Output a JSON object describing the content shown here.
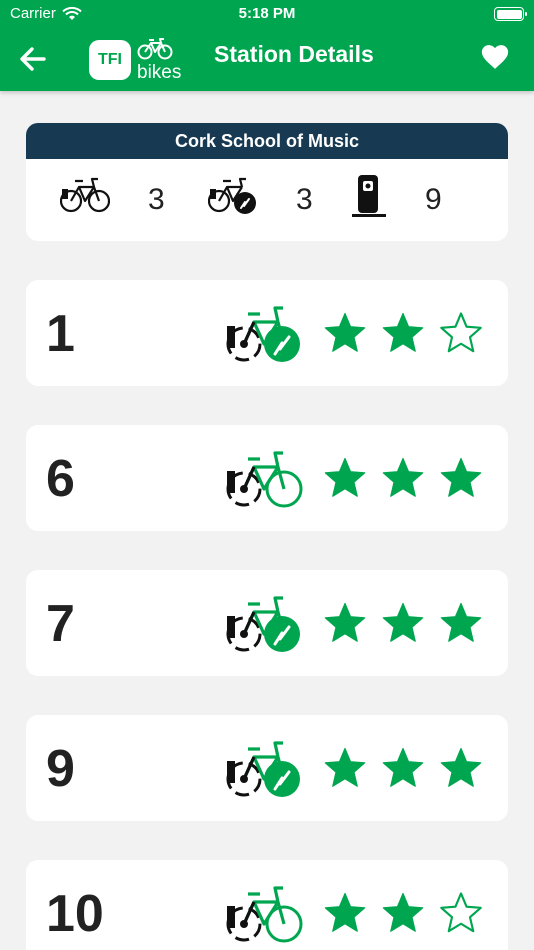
{
  "status_bar": {
    "carrier": "Carrier",
    "time": "5:18 PM"
  },
  "header": {
    "title": "Station Details",
    "logo_tfi": "TFI",
    "logo_bikes": "bikes"
  },
  "colors": {
    "brand_green": "#00a64f",
    "station_bar": "#173a52",
    "background": "#f2f2f2"
  },
  "station": {
    "name": "Cork School of Music",
    "bikes": "3",
    "ebikes": "3",
    "docks": "9"
  },
  "bikes": [
    {
      "number": "1",
      "type": "electric",
      "rating": 2,
      "max_rating": 3
    },
    {
      "number": "6",
      "type": "regular",
      "rating": 3,
      "max_rating": 3
    },
    {
      "number": "7",
      "type": "electric",
      "rating": 3,
      "max_rating": 3
    },
    {
      "number": "9",
      "type": "electric",
      "rating": 3,
      "max_rating": 3
    },
    {
      "number": "10",
      "type": "regular",
      "rating": 2,
      "max_rating": 3
    }
  ]
}
